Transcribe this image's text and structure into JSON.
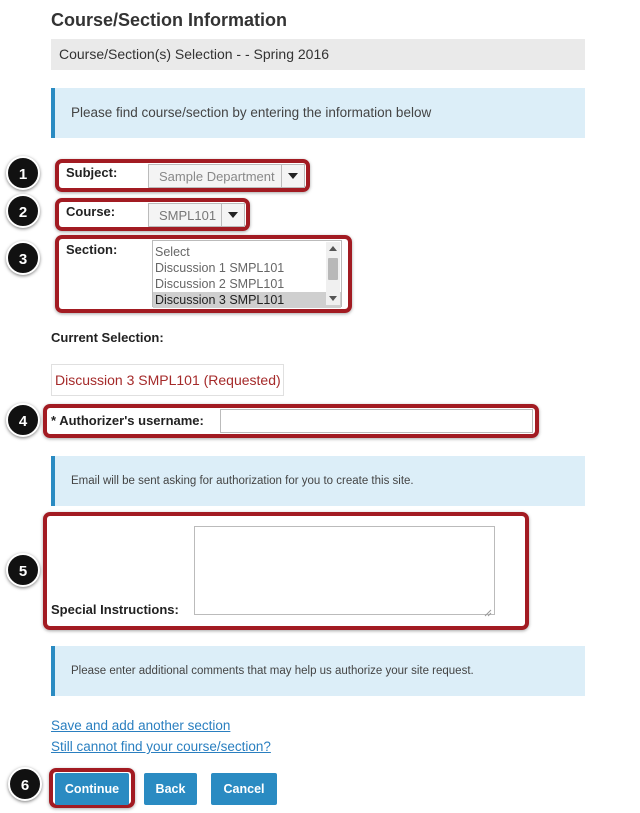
{
  "page": {
    "title": "Course/Section Information",
    "selection_bar": "Course/Section(s) Selection - - Spring 2016",
    "info_find": "Please find course/section by entering the information below",
    "info_email": "Email will be sent asking for authorization for you to create this site.",
    "info_comments": "Please enter additional comments that may help us authorize your site request."
  },
  "form": {
    "subject_label": "Subject:",
    "subject_value": "Sample Department",
    "course_label": "Course:",
    "course_value": "SMPL101",
    "section_label": "Section:",
    "section_options": [
      "Select",
      "Discussion 1 SMPL101",
      "Discussion 2 SMPL101",
      "Discussion 3 SMPL101"
    ],
    "section_selected_index": 3,
    "current_selection_label": "Current Selection:",
    "current_selection_value": "Discussion 3 SMPL101 (Requested)",
    "authorizer_label": "* Authorizer's username:",
    "authorizer_value": "",
    "special_label": "Special Instructions:",
    "special_value": ""
  },
  "links": {
    "save_add": "Save and add another section",
    "cannot_find": "Still cannot find your course/section?"
  },
  "buttons": {
    "continue": "Continue",
    "back": "Back",
    "cancel": "Cancel"
  },
  "callouts": [
    "1",
    "2",
    "3",
    "4",
    "5",
    "6"
  ],
  "colors": {
    "accent": "#2a8bc2",
    "highlight": "#a21b22",
    "info_bg": "#dceef8",
    "requested": "#a52a2a"
  }
}
